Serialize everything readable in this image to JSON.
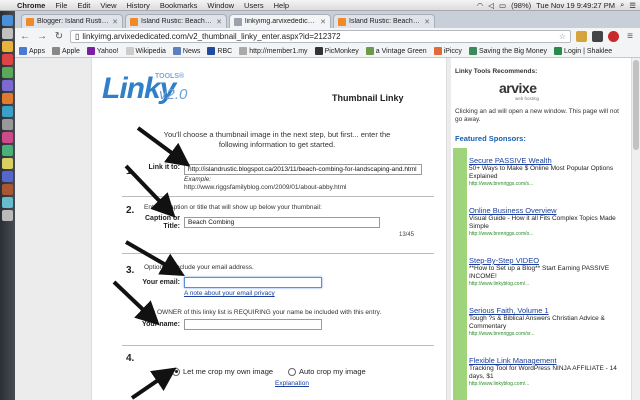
{
  "menubar": {
    "app": "Chrome",
    "items": [
      "File",
      "Edit",
      "View",
      "History",
      "Bookmarks",
      "Window",
      "Users",
      "Help"
    ],
    "battery": "(98%)",
    "clock": "Tue Nov 19  9:49:27 PM"
  },
  "tabs": [
    {
      "label": "Blogger: Island Rustic - A",
      "color": "#f08a24"
    },
    {
      "label": "Island Rustic: Beach Comb",
      "color": "#f08a24"
    },
    {
      "label": "linkyimg.arvixededicated.c",
      "color": "#9aa3ad"
    },
    {
      "label": "Island Rustic: Beach Comb",
      "color": "#f08a24"
    }
  ],
  "address": {
    "url": "linkyimg.arvixededicated.com/v2_thumbnail_linky_enter.aspx?id=212372"
  },
  "bookmarks": [
    "Apps",
    "Apple",
    "Yahoo!",
    "Wikipedia",
    "News",
    "RBC",
    "http://member1.my",
    "PicMonkey",
    "a Vintage Green",
    "iPiccy",
    "Saving the Big Money",
    "Login | Shaklee"
  ],
  "form": {
    "logo_main": "Linky",
    "logo_tools": "TOOLS®",
    "logo_version": "v2.0",
    "heading": "Thumbnail Linky",
    "intro": "You'll choose a thumbnail image in the next step, but first... enter the following information to get started.",
    "step1": "1.",
    "link_label": "Link it to:",
    "link_value": "http://islandrustic.blogspot.ca/2013/11/beach-combing-for-landscaping-and.html",
    "example_label": "Example:",
    "example_url": "http://www.riggsfamilyblog.com/2009/01/about-abby.html",
    "step2": "2.",
    "caption_intro": "Enter a caption or title that will show up below your thumbnail:",
    "caption_label": "Caption or Title:",
    "caption_value": "Beach Combing",
    "counter": "13/45",
    "step3": "3.",
    "email_intro": "Optionally include your email address.",
    "email_label": "Your email:",
    "email_value": "",
    "privacy_link": "A note about your email privacy",
    "owner_note": "The OWNER of this linky list is REQUIRING your name be included with this entry.",
    "name_label": "Your name:",
    "name_value": "",
    "step4": "4.",
    "opt1": "Let me crop my own image",
    "opt2": "Auto crop my image",
    "explanation": "Explanation"
  },
  "sidebar": {
    "recommends": "Linky Tools Recommends:",
    "sponsor_name": "arvixe",
    "sponsor_tag": "web hosting",
    "note": "Clicking an ad will open a new window. This page will not go away.",
    "featured": "Featured Sponsors:",
    "ads": [
      {
        "title": "Secure PASSIVE Wealth",
        "body": "50+ Ways to Make $ Online Most Popular Options Explained",
        "url": "http://www.brenriggs.com/s..."
      },
      {
        "title": "Online Business Overview",
        "body": "Visual Guide - How it all Fits Complex Topics Made Simple",
        "url": "http://www.brenriggs.com/o..."
      },
      {
        "title": "Step-By-Step VIDEO",
        "body": "**How to Set up a Blog** Start Earning PASSIVE INCOME!",
        "url": "http://www.linkyblog.com/..."
      },
      {
        "title": "Serious Faith, Volume 1",
        "body": "Tough ?s & Biblical Answers Christian Advice & Commentary",
        "url": "http://www.brenriggs.com/sr..."
      },
      {
        "title": "Flexible Link Management",
        "body": "Tracking Tool for WordPress NINJA AFFILIATE - 14 days, $1",
        "url": "http://www.linkyblog.com/..."
      }
    ]
  }
}
